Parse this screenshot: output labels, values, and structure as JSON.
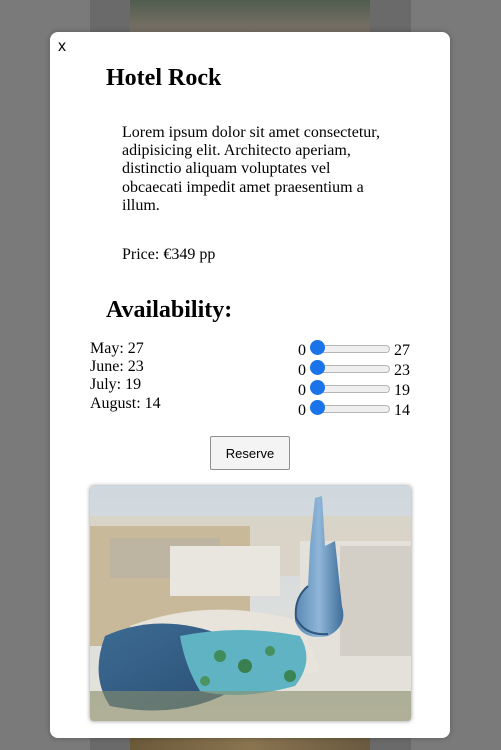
{
  "modal": {
    "close_label": "x",
    "title": "Hotel Rock",
    "description": "Lorem ipsum dolor sit amet consectetur, adipisicing elit. Architecto aperiam, distinctio aliquam voluptates vel obcaecati impedit amet praesentium a illum.",
    "price": "Price: €349 pp",
    "availability_title": "Availability:",
    "availability": [
      {
        "label": "May: 27",
        "min": "0",
        "max": "27",
        "value": 0
      },
      {
        "label": "June: 23",
        "min": "0",
        "max": "23",
        "value": 0
      },
      {
        "label": "July: 19",
        "min": "0",
        "max": "19",
        "value": 0
      },
      {
        "label": "August: 14",
        "min": "0",
        "max": "14",
        "value": 0
      }
    ],
    "reserve_label": "Reserve",
    "image_icon": "hotel-photo"
  },
  "colors": {
    "slider_thumb": "#1a73e8",
    "overlay": "#7a7a7a"
  }
}
